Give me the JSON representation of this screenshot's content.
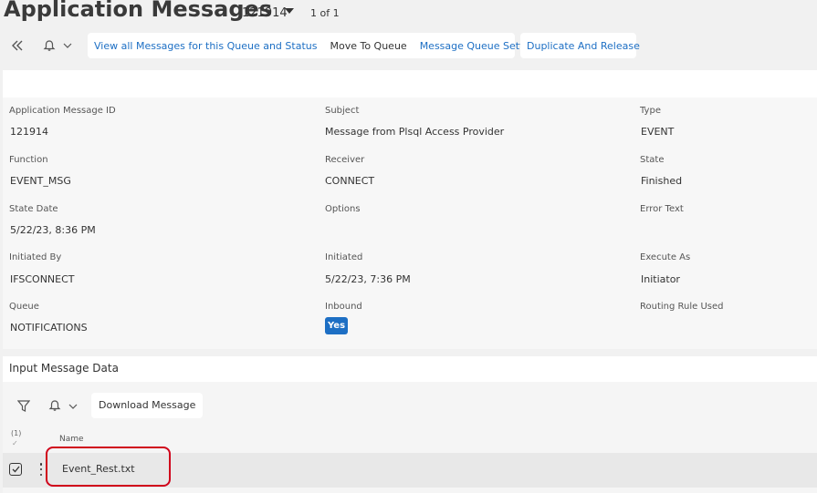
{
  "header": {
    "title": "Application Messages",
    "record_id": "121914",
    "record_count": "1 of 1"
  },
  "toolbar": {
    "collapse_icon": "double-chevron-left-icon",
    "notify_icon": "bell-icon",
    "view_all_label": "View all Messages for this Queue and Status",
    "move_to_queue_label": "Move To Queue",
    "queue_settings_label": "Message Queue Settings",
    "duplicate_release_label": "Duplicate And Release"
  },
  "details": {
    "fields": [
      {
        "label": "Application Message ID",
        "value": "121914"
      },
      {
        "label": "Subject",
        "value": "Message from Plsql Access Provider"
      },
      {
        "label": "Type",
        "value": "EVENT"
      },
      {
        "label": "Function",
        "value": "EVENT_MSG"
      },
      {
        "label": "Receiver",
        "value": "CONNECT"
      },
      {
        "label": "State",
        "value": "Finished"
      },
      {
        "label": "State Date",
        "value": "5/22/23, 8:36 PM"
      },
      {
        "label": "Options",
        "value": ""
      },
      {
        "label": "Error Text",
        "value": ""
      },
      {
        "label": "Initiated By",
        "value": "IFSCONNECT"
      },
      {
        "label": "Initiated",
        "value": "5/22/23, 7:36 PM"
      },
      {
        "label": "Execute As",
        "value": "Initiator"
      },
      {
        "label": "Queue",
        "value": "NOTIFICATIONS"
      },
      {
        "label": "Inbound",
        "value": "Yes"
      },
      {
        "label": "Routing Rule Used",
        "value": ""
      }
    ]
  },
  "input_data": {
    "title": "Input Message Data",
    "download_label": "Download Message",
    "selected_count": "(1)",
    "check_mark": "✓",
    "column_name": "Name",
    "rows": [
      {
        "name": "Event_Rest.txt"
      }
    ]
  },
  "colors": {
    "accent": "#1d6fc4",
    "highlight": "#d0021b",
    "background": "#f1f1f1"
  }
}
